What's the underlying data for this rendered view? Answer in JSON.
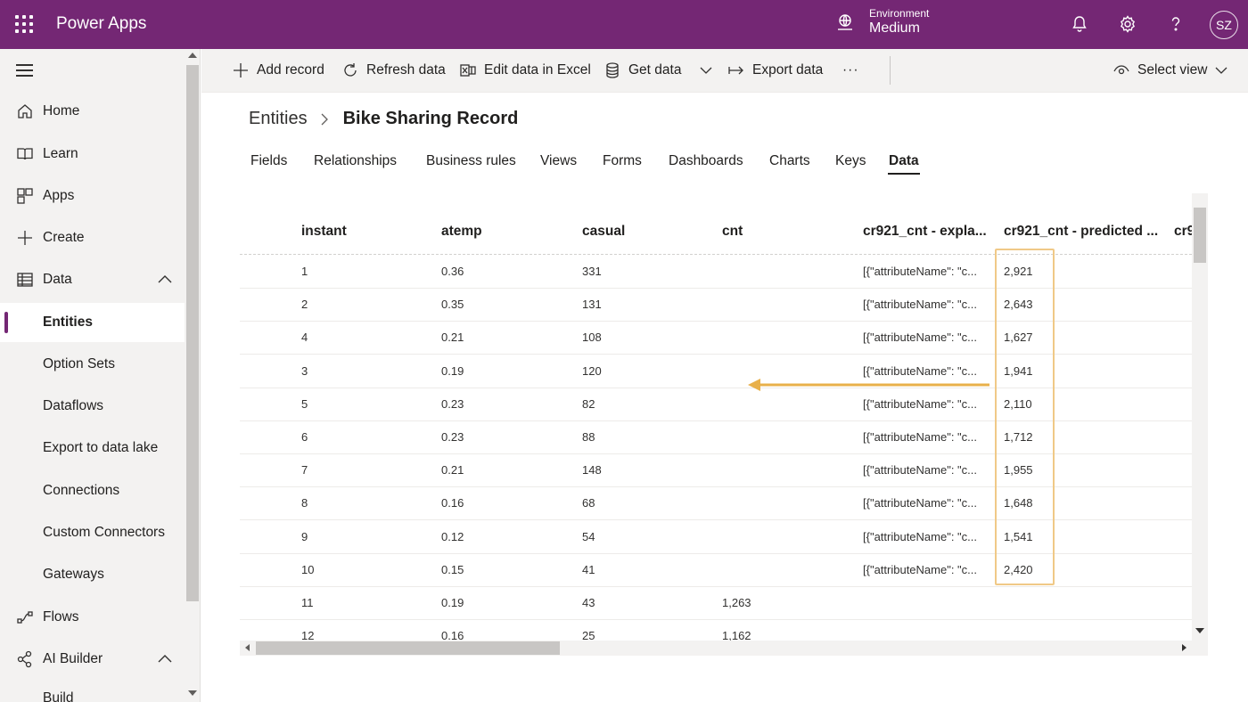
{
  "header": {
    "app_title": "Power Apps",
    "environment_label": "Environment",
    "environment_name": "Medium",
    "avatar_initials": "SZ",
    "brand_color": "#742774"
  },
  "sidebar": {
    "items": [
      {
        "label": "Home",
        "icon": "home-icon"
      },
      {
        "label": "Learn",
        "icon": "book-icon"
      },
      {
        "label": "Apps",
        "icon": "apps-icon"
      },
      {
        "label": "Create",
        "icon": "plus-icon"
      },
      {
        "label": "Data",
        "icon": "table-icon",
        "expanded": true
      },
      {
        "label": "Entities",
        "selected": true
      },
      {
        "label": "Option Sets"
      },
      {
        "label": "Dataflows"
      },
      {
        "label": "Export to data lake"
      },
      {
        "label": "Connections"
      },
      {
        "label": "Custom Connectors"
      },
      {
        "label": "Gateways"
      },
      {
        "label": "Flows",
        "icon": "flow-icon"
      },
      {
        "label": "AI Builder",
        "icon": "ai-builder-icon",
        "expanded": true
      },
      {
        "label": "Build"
      }
    ]
  },
  "commands": {
    "add_record": "Add record",
    "refresh_data": "Refresh data",
    "edit_excel": "Edit data in Excel",
    "get_data": "Get data",
    "export_data": "Export data",
    "more": "···",
    "select_view": "Select view"
  },
  "breadcrumb": {
    "parent": "Entities",
    "current": "Bike Sharing Record"
  },
  "tabs": [
    "Fields",
    "Relationships",
    "Business rules",
    "Views",
    "Forms",
    "Dashboards",
    "Charts",
    "Keys",
    "Data"
  ],
  "active_tab": "Data",
  "grid": {
    "columns": [
      "instant",
      "atemp",
      "casual",
      "cnt",
      "cr921_cnt - expla...",
      "cr921_cnt - predicted ...",
      "cr9"
    ],
    "rows": [
      {
        "instant": "1",
        "atemp": "0.36",
        "casual": "331",
        "cnt": "",
        "explain": "[{\"attributeName\": \"c...",
        "predicted": "2,921"
      },
      {
        "instant": "2",
        "atemp": "0.35",
        "casual": "131",
        "cnt": "",
        "explain": "[{\"attributeName\": \"c...",
        "predicted": "2,643"
      },
      {
        "instant": "4",
        "atemp": "0.21",
        "casual": "108",
        "cnt": "",
        "explain": "[{\"attributeName\": \"c...",
        "predicted": "1,627"
      },
      {
        "instant": "3",
        "atemp": "0.19",
        "casual": "120",
        "cnt": "",
        "explain": "[{\"attributeName\": \"c...",
        "predicted": "1,941"
      },
      {
        "instant": "5",
        "atemp": "0.23",
        "casual": "82",
        "cnt": "",
        "explain": "[{\"attributeName\": \"c...",
        "predicted": "2,110"
      },
      {
        "instant": "6",
        "atemp": "0.23",
        "casual": "88",
        "cnt": "",
        "explain": "[{\"attributeName\": \"c...",
        "predicted": "1,712"
      },
      {
        "instant": "7",
        "atemp": "0.21",
        "casual": "148",
        "cnt": "",
        "explain": "[{\"attributeName\": \"c...",
        "predicted": "1,955"
      },
      {
        "instant": "8",
        "atemp": "0.16",
        "casual": "68",
        "cnt": "",
        "explain": "[{\"attributeName\": \"c...",
        "predicted": "1,648"
      },
      {
        "instant": "9",
        "atemp": "0.12",
        "casual": "54",
        "cnt": "",
        "explain": "[{\"attributeName\": \"c...",
        "predicted": "1,541"
      },
      {
        "instant": "10",
        "atemp": "0.15",
        "casual": "41",
        "cnt": "",
        "explain": "[{\"attributeName\": \"c...",
        "predicted": "2,420"
      },
      {
        "instant": "11",
        "atemp": "0.19",
        "casual": "43",
        "cnt": "1,263",
        "explain": "",
        "predicted": ""
      },
      {
        "instant": "12",
        "atemp": "0.16",
        "casual": "25",
        "cnt": "1,162",
        "explain": "",
        "predicted": ""
      }
    ]
  },
  "annotation_color": "#e8b04a"
}
